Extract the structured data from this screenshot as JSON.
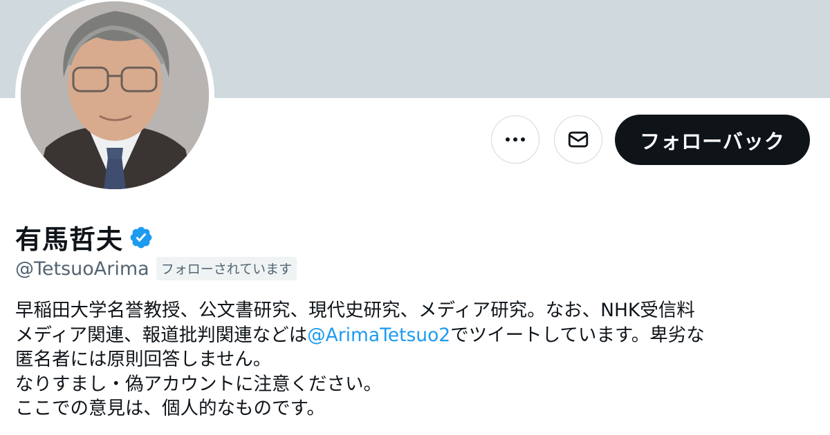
{
  "colors": {
    "banner": "#cfd9de",
    "primary_button_bg": "#0f1419",
    "link": "#1d9bf0",
    "verified_badge": "#1d9bf0",
    "secondary_text": "#536471"
  },
  "header": {
    "banner_icon": "profile-banner",
    "avatar_icon": "profile-avatar-photo"
  },
  "actions": {
    "more_icon": "more-horizontal-icon",
    "message_icon": "mail-icon",
    "follow_back_label": "フォローバック"
  },
  "profile": {
    "display_name": "有馬哲夫",
    "verified_icon": "verified-badge-icon",
    "handle": "@TetsuoArima",
    "follows_you_label": "フォローされています"
  },
  "bio": {
    "line1": "早稲田大学名誉教授、公文書研究、現代史研究、メディア研究。なお、NHK受信料",
    "line2_before": "メディア関連、報道批判関連などは",
    "line2_mention": "@ArimaTetsuo2",
    "line2_after": "でツイートしています。卑劣な",
    "line3": "匿名者には原則回答しません。",
    "line4": "なりすまし・偽アカウントに注意ください。",
    "line5": "ここでの意見は、個人的なものです。"
  }
}
